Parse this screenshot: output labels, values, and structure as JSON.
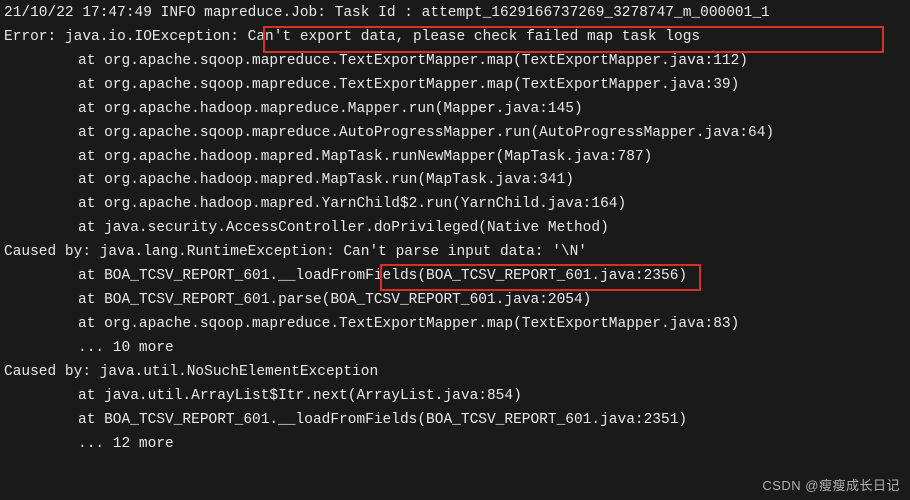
{
  "lines": [
    "21/10/22 17:47:49 INFO mapreduce.Job: Task Id : attempt_1629166737269_3278747_m_000001_1",
    "Error: java.io.IOException: Can't export data, please check failed map task logs",
    "at org.apache.sqoop.mapreduce.TextExportMapper.map(TextExportMapper.java:112)",
    "at org.apache.sqoop.mapreduce.TextExportMapper.map(TextExportMapper.java:39)",
    "at org.apache.hadoop.mapreduce.Mapper.run(Mapper.java:145)",
    "at org.apache.sqoop.mapreduce.AutoProgressMapper.run(AutoProgressMapper.java:64)",
    "at org.apache.hadoop.mapred.MapTask.runNewMapper(MapTask.java:787)",
    "at org.apache.hadoop.mapred.MapTask.run(MapTask.java:341)",
    "at org.apache.hadoop.mapred.YarnChild$2.run(YarnChild.java:164)",
    "at java.security.AccessController.doPrivileged(Native Method)",
    "Caused by: java.lang.RuntimeException: Can't parse input data: '\\N'",
    "at BOA_TCSV_REPORT_601.__loadFromFields(BOA_TCSV_REPORT_601.java:2356)",
    "at BOA_TCSV_REPORT_601.parse(BOA_TCSV_REPORT_601.java:2054)",
    "at org.apache.sqoop.mapreduce.TextExportMapper.map(TextExportMapper.java:83)",
    "... 10 more",
    "Caused by: java.util.NoSuchElementException",
    "at java.util.ArrayList$Itr.next(ArrayList.java:854)",
    "at BOA_TCSV_REPORT_601.__loadFromFields(BOA_TCSV_REPORT_601.java:2351)",
    "... 12 more"
  ],
  "indent_flags": [
    false,
    false,
    true,
    true,
    true,
    true,
    true,
    true,
    true,
    true,
    false,
    true,
    true,
    true,
    true,
    false,
    true,
    true,
    true
  ],
  "watermark": "CSDN @瘦瘦成长日记"
}
